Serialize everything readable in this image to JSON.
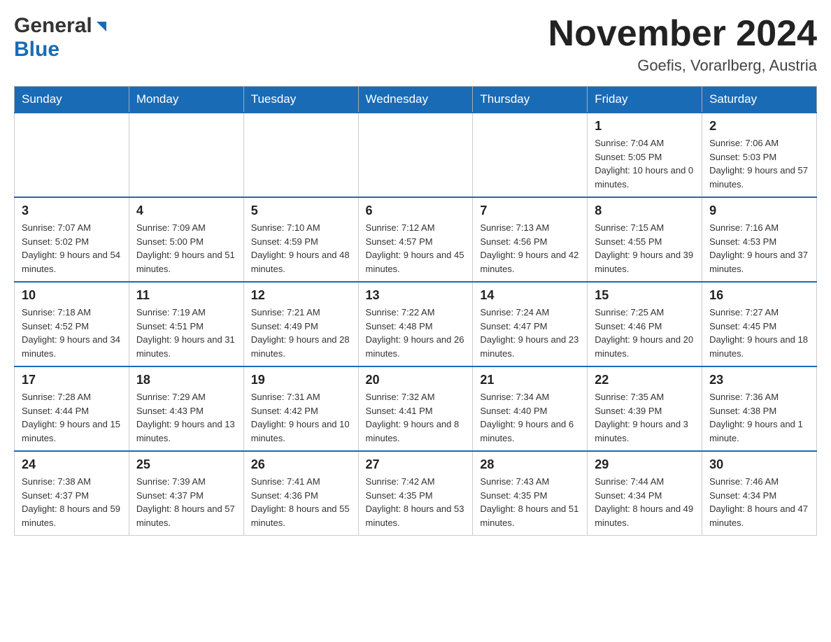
{
  "header": {
    "logo_general": "General",
    "logo_blue": "Blue",
    "month_title": "November 2024",
    "subtitle": "Goefis, Vorarlberg, Austria"
  },
  "days_of_week": [
    "Sunday",
    "Monday",
    "Tuesday",
    "Wednesday",
    "Thursday",
    "Friday",
    "Saturday"
  ],
  "weeks": [
    [
      {
        "day": "",
        "info": ""
      },
      {
        "day": "",
        "info": ""
      },
      {
        "day": "",
        "info": ""
      },
      {
        "day": "",
        "info": ""
      },
      {
        "day": "",
        "info": ""
      },
      {
        "day": "1",
        "info": "Sunrise: 7:04 AM\nSunset: 5:05 PM\nDaylight: 10 hours and 0 minutes."
      },
      {
        "day": "2",
        "info": "Sunrise: 7:06 AM\nSunset: 5:03 PM\nDaylight: 9 hours and 57 minutes."
      }
    ],
    [
      {
        "day": "3",
        "info": "Sunrise: 7:07 AM\nSunset: 5:02 PM\nDaylight: 9 hours and 54 minutes."
      },
      {
        "day": "4",
        "info": "Sunrise: 7:09 AM\nSunset: 5:00 PM\nDaylight: 9 hours and 51 minutes."
      },
      {
        "day": "5",
        "info": "Sunrise: 7:10 AM\nSunset: 4:59 PM\nDaylight: 9 hours and 48 minutes."
      },
      {
        "day": "6",
        "info": "Sunrise: 7:12 AM\nSunset: 4:57 PM\nDaylight: 9 hours and 45 minutes."
      },
      {
        "day": "7",
        "info": "Sunrise: 7:13 AM\nSunset: 4:56 PM\nDaylight: 9 hours and 42 minutes."
      },
      {
        "day": "8",
        "info": "Sunrise: 7:15 AM\nSunset: 4:55 PM\nDaylight: 9 hours and 39 minutes."
      },
      {
        "day": "9",
        "info": "Sunrise: 7:16 AM\nSunset: 4:53 PM\nDaylight: 9 hours and 37 minutes."
      }
    ],
    [
      {
        "day": "10",
        "info": "Sunrise: 7:18 AM\nSunset: 4:52 PM\nDaylight: 9 hours and 34 minutes."
      },
      {
        "day": "11",
        "info": "Sunrise: 7:19 AM\nSunset: 4:51 PM\nDaylight: 9 hours and 31 minutes."
      },
      {
        "day": "12",
        "info": "Sunrise: 7:21 AM\nSunset: 4:49 PM\nDaylight: 9 hours and 28 minutes."
      },
      {
        "day": "13",
        "info": "Sunrise: 7:22 AM\nSunset: 4:48 PM\nDaylight: 9 hours and 26 minutes."
      },
      {
        "day": "14",
        "info": "Sunrise: 7:24 AM\nSunset: 4:47 PM\nDaylight: 9 hours and 23 minutes."
      },
      {
        "day": "15",
        "info": "Sunrise: 7:25 AM\nSunset: 4:46 PM\nDaylight: 9 hours and 20 minutes."
      },
      {
        "day": "16",
        "info": "Sunrise: 7:27 AM\nSunset: 4:45 PM\nDaylight: 9 hours and 18 minutes."
      }
    ],
    [
      {
        "day": "17",
        "info": "Sunrise: 7:28 AM\nSunset: 4:44 PM\nDaylight: 9 hours and 15 minutes."
      },
      {
        "day": "18",
        "info": "Sunrise: 7:29 AM\nSunset: 4:43 PM\nDaylight: 9 hours and 13 minutes."
      },
      {
        "day": "19",
        "info": "Sunrise: 7:31 AM\nSunset: 4:42 PM\nDaylight: 9 hours and 10 minutes."
      },
      {
        "day": "20",
        "info": "Sunrise: 7:32 AM\nSunset: 4:41 PM\nDaylight: 9 hours and 8 minutes."
      },
      {
        "day": "21",
        "info": "Sunrise: 7:34 AM\nSunset: 4:40 PM\nDaylight: 9 hours and 6 minutes."
      },
      {
        "day": "22",
        "info": "Sunrise: 7:35 AM\nSunset: 4:39 PM\nDaylight: 9 hours and 3 minutes."
      },
      {
        "day": "23",
        "info": "Sunrise: 7:36 AM\nSunset: 4:38 PM\nDaylight: 9 hours and 1 minute."
      }
    ],
    [
      {
        "day": "24",
        "info": "Sunrise: 7:38 AM\nSunset: 4:37 PM\nDaylight: 8 hours and 59 minutes."
      },
      {
        "day": "25",
        "info": "Sunrise: 7:39 AM\nSunset: 4:37 PM\nDaylight: 8 hours and 57 minutes."
      },
      {
        "day": "26",
        "info": "Sunrise: 7:41 AM\nSunset: 4:36 PM\nDaylight: 8 hours and 55 minutes."
      },
      {
        "day": "27",
        "info": "Sunrise: 7:42 AM\nSunset: 4:35 PM\nDaylight: 8 hours and 53 minutes."
      },
      {
        "day": "28",
        "info": "Sunrise: 7:43 AM\nSunset: 4:35 PM\nDaylight: 8 hours and 51 minutes."
      },
      {
        "day": "29",
        "info": "Sunrise: 7:44 AM\nSunset: 4:34 PM\nDaylight: 8 hours and 49 minutes."
      },
      {
        "day": "30",
        "info": "Sunrise: 7:46 AM\nSunset: 4:34 PM\nDaylight: 8 hours and 47 minutes."
      }
    ]
  ]
}
